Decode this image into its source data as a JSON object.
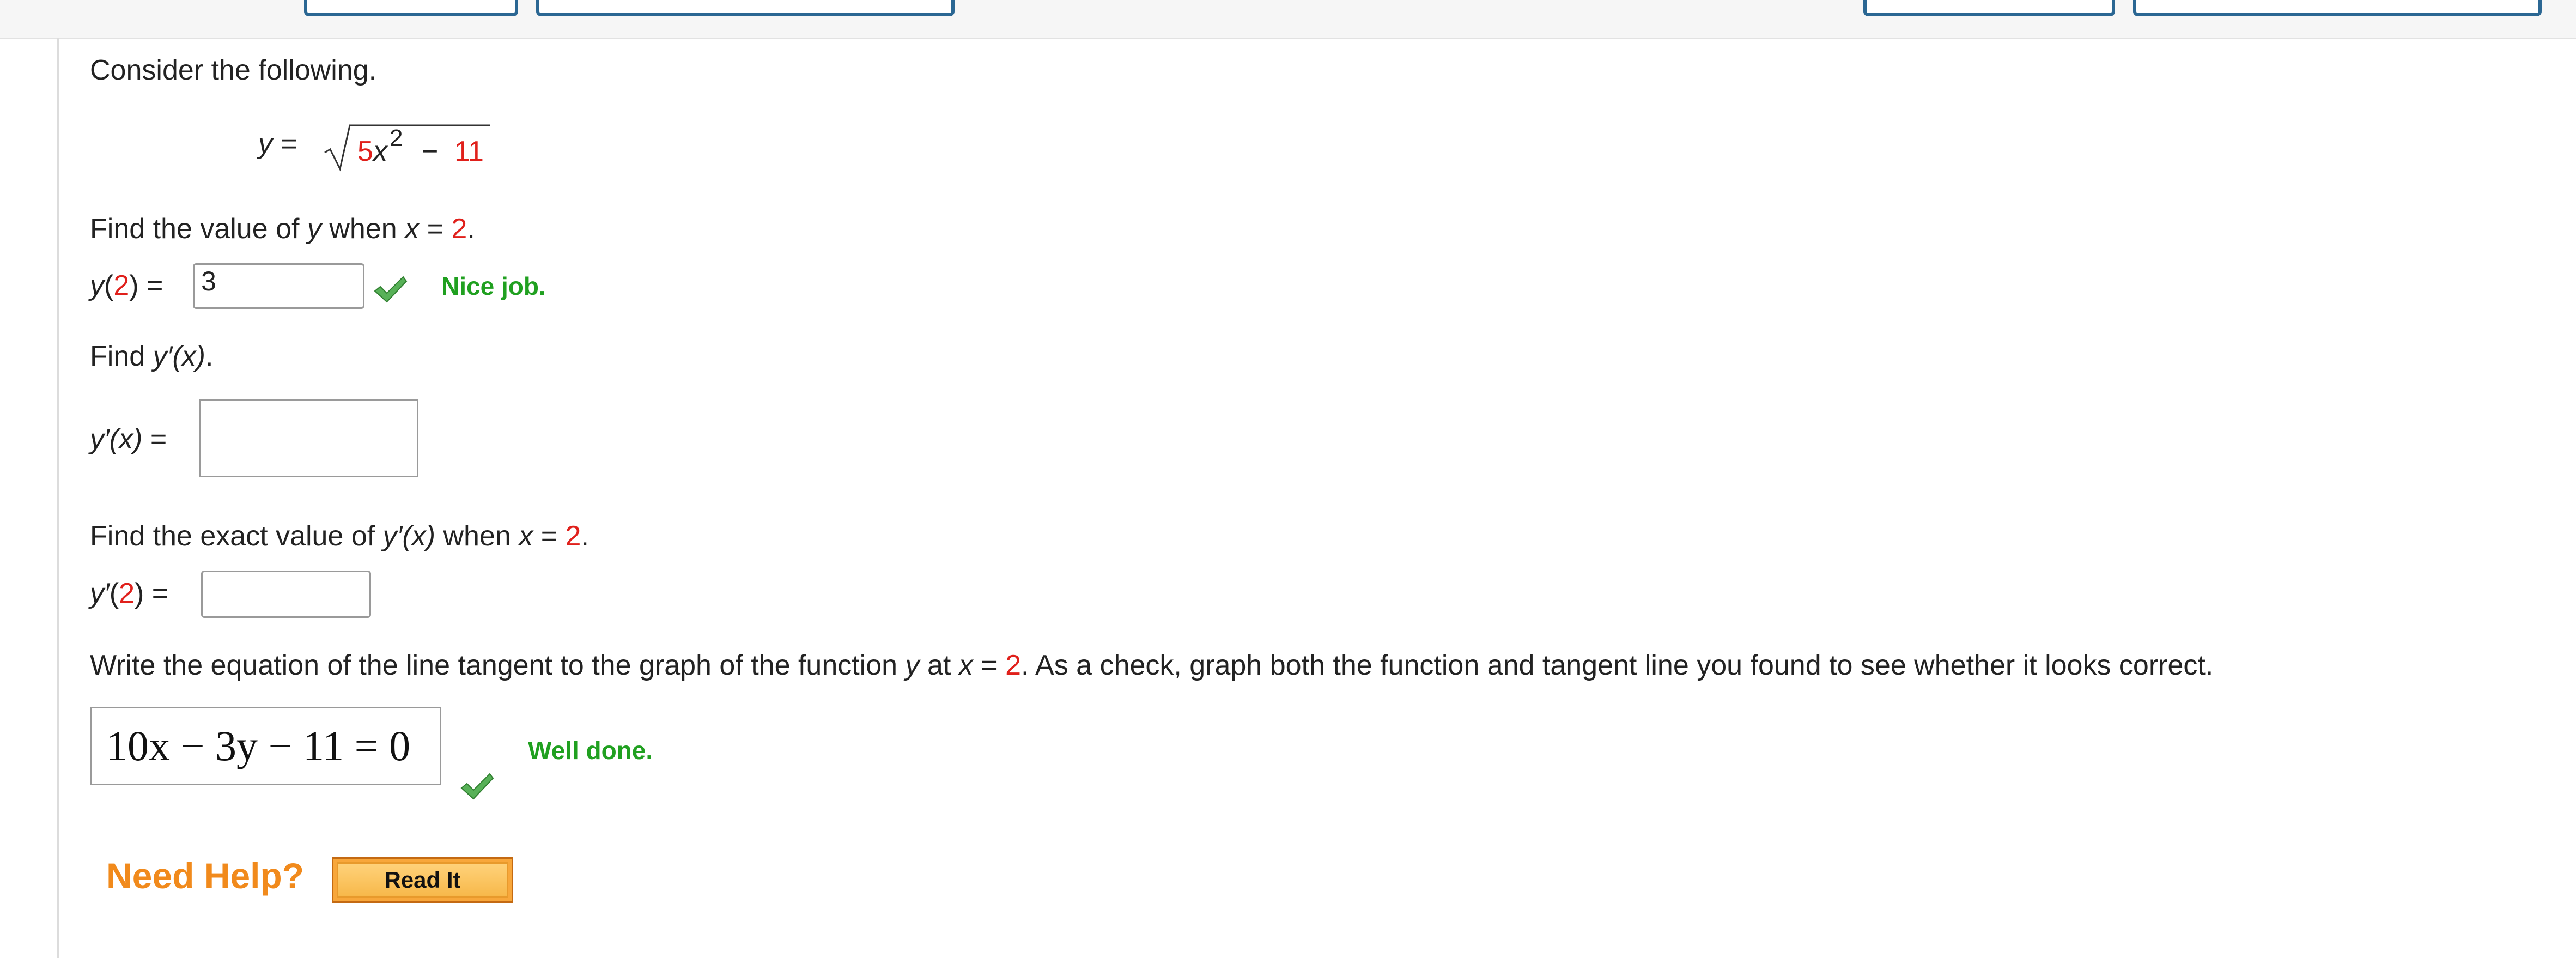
{
  "intro": "Consider the following.",
  "function": {
    "y_eq": "y =",
    "coef": "5",
    "var": "x",
    "exp": "2",
    "minus": "−",
    "const": "11"
  },
  "q1": {
    "prompt_a": "Find the value of",
    "prompt_var": "y",
    "prompt_b": "when",
    "prompt_x": "x",
    "prompt_eq": "=",
    "x_value": "2",
    "period": ".",
    "label_y": "y",
    "label_open": "(",
    "label_arg": "2",
    "label_close": ")",
    "label_eq": "=",
    "answer": "3",
    "feedback": "Nice job."
  },
  "q2": {
    "prompt_a": "Find",
    "prompt_expr": "y′(x)",
    "period": ".",
    "label": "y′(x)",
    "label_eq": "=",
    "answer": ""
  },
  "q3": {
    "prompt_a": "Find the exact value of",
    "prompt_expr": "y′(x)",
    "prompt_b": "when",
    "prompt_x": "x",
    "prompt_eq": "=",
    "x_value": "2",
    "period": ".",
    "label_y": "y′",
    "label_open": "(",
    "label_arg": "2",
    "label_close": ")",
    "label_eq": "=",
    "answer": ""
  },
  "q4": {
    "prompt_a": "Write the equation of the line tangent to the graph of the function",
    "prompt_var": "y",
    "prompt_b": "at",
    "prompt_x": "x",
    "prompt_eq": "=",
    "x_value": "2",
    "prompt_c": ". As a check, graph both the function and tangent line you found to see whether it looks correct.",
    "answer": "10x − 3y − 11 = 0",
    "feedback": "Well done."
  },
  "help": {
    "need_help": "Need Help?",
    "read_it": "Read It"
  },
  "icons": {
    "check": "checkmark-icon"
  },
  "colors": {
    "accent_red": "#e0201b",
    "correct_green": "#20a020",
    "help_orange": "#f18a1c",
    "button_orange": "#f8a73b"
  }
}
